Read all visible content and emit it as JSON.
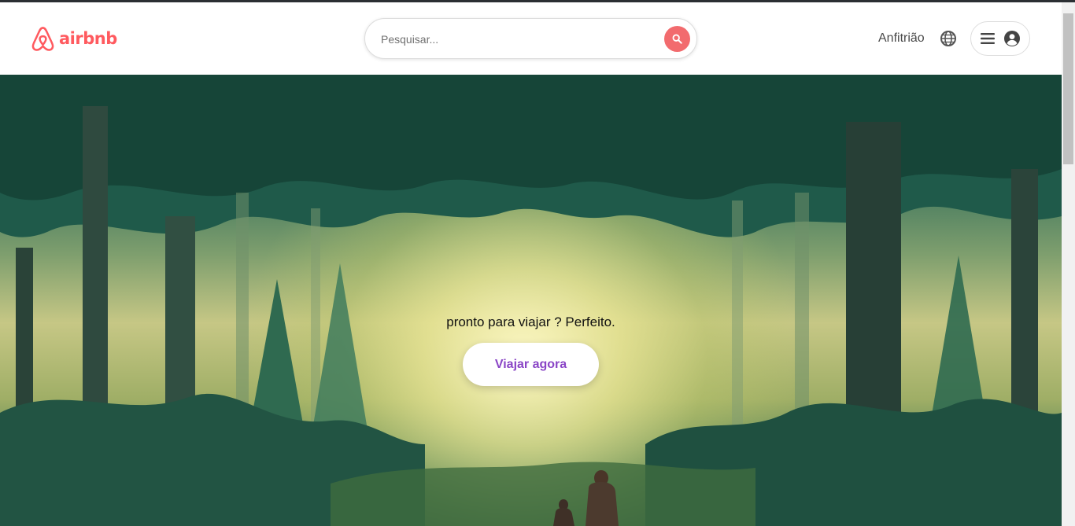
{
  "brand": {
    "name": "airbnb",
    "color": "#ff5a5f"
  },
  "search": {
    "placeholder": "Pesquisar...",
    "button_icon": "search-icon"
  },
  "nav": {
    "host_label": "Anfitrião",
    "language_icon": "globe-icon",
    "menu_icon": "hamburger-icon",
    "profile_icon": "user-circle-icon"
  },
  "hero": {
    "tagline": "pronto para viajar ? Perfeito.",
    "cta_label": "Viajar agora",
    "cta_color": "#8a45c6"
  }
}
